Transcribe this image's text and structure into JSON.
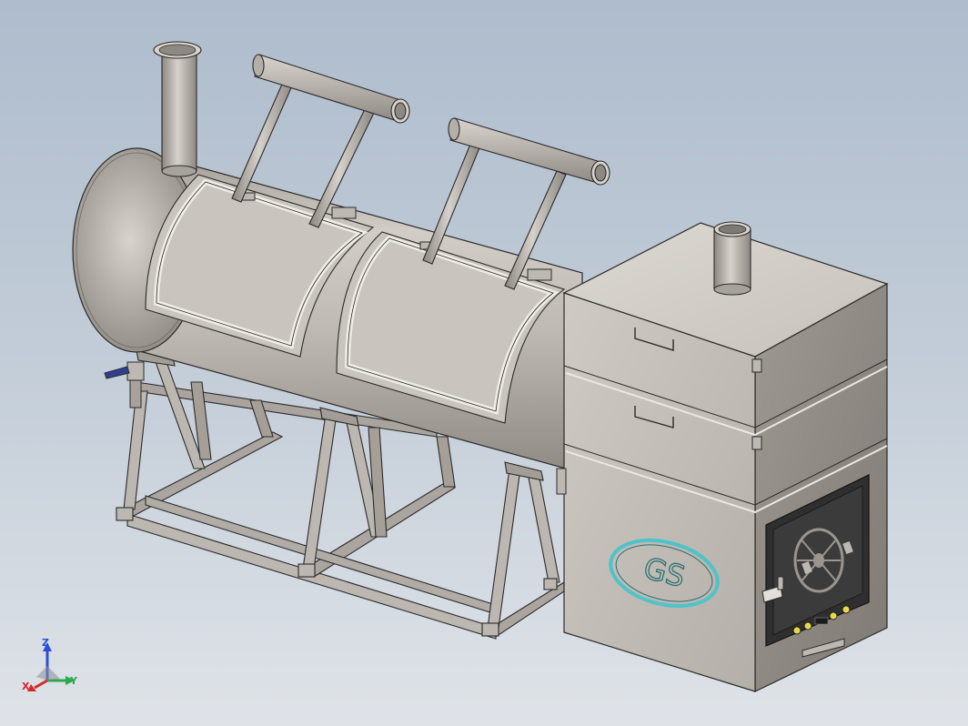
{
  "viewport": {
    "background_top": "#aebccd",
    "background_bottom": "#dfe3e8"
  },
  "model": {
    "logo_text": "GS",
    "logo_color": "#4ec3c9",
    "body_color": "#c4bfb8",
    "frame_color": "#b9b4ad",
    "outline_color": "#2b2b2b"
  },
  "triad": {
    "z_label": "Z",
    "y_label": "Y",
    "x_label": "X",
    "x_color": "#d42a2a",
    "y_color": "#2aa84a",
    "z_color": "#2a4fd4"
  }
}
